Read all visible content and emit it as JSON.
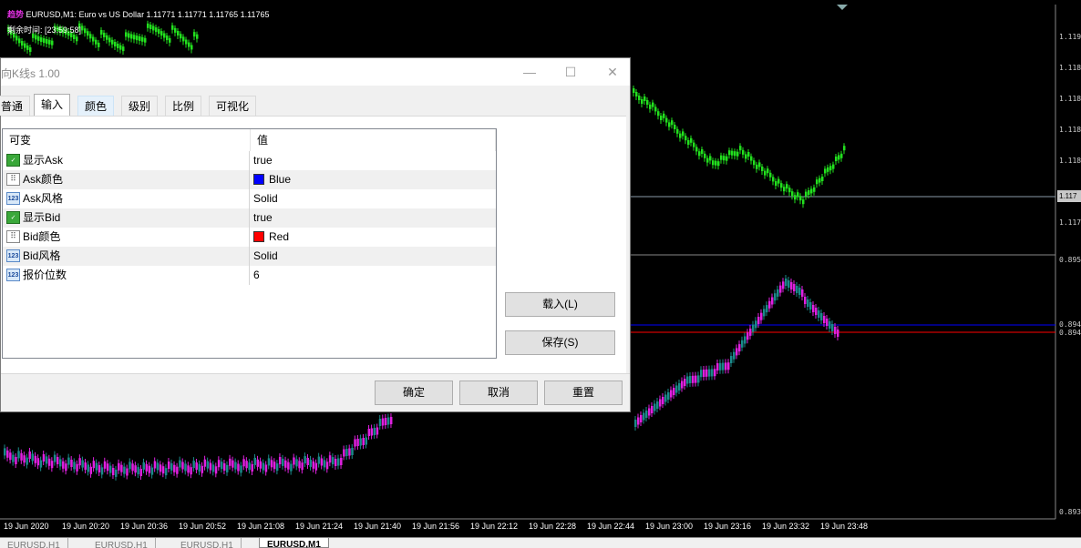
{
  "chart": {
    "symbol_header": "EURUSD,M1:  Euro vs US Dollar  1.11771 1.11771 1.11765 1.11765",
    "logo_text": "趋势",
    "remaining_label": "剩余时间: [23:59:58]",
    "colors": {
      "background": "#000000",
      "bull_upper": "#22e01e",
      "bear_lower": "#e020e0",
      "bull_lower": "#1a8a8a",
      "ask_line": "#0000ff",
      "bid_line": "#ff0000"
    },
    "price_labels": [
      {
        "text": "1.119"
      },
      {
        "text": "1.118"
      },
      {
        "text": "1.118"
      },
      {
        "text": "1.118"
      },
      {
        "text": "1.118"
      },
      {
        "text": "1.117"
      },
      {
        "text": "0.895"
      },
      {
        "text": "0.894"
      },
      {
        "text": "0.894"
      },
      {
        "text": "0.893"
      }
    ],
    "current_price": "1.117",
    "time_labels": [
      "19 Jun 2020",
      "19 Jun 20:20",
      "19 Jun 20:36",
      "19 Jun 20:52",
      "19 Jun 21:08",
      "19 Jun 21:24",
      "19 Jun 21:40",
      "19 Jun 21:56",
      "19 Jun 22:12",
      "19 Jun 22:28",
      "19 Jun 22:44",
      "19 Jun 23:00",
      "19 Jun 23:16",
      "19 Jun 23:32",
      "19 Jun 23:48"
    ],
    "tabs": [
      {
        "label": "EURUSD,H1",
        "active": false
      },
      {
        "label": "EURUSD,H1",
        "active": false
      },
      {
        "label": "EURUSD,H1",
        "active": false
      },
      {
        "label": "EURUSD,M1",
        "active": true
      }
    ]
  },
  "dialog": {
    "title": "向K线s 1.00",
    "minimize": "—",
    "maximize": "☐",
    "close": "✕",
    "tabs": [
      {
        "label": "普通",
        "state": "normal"
      },
      {
        "label": "输入",
        "state": "active"
      },
      {
        "label": "颜色",
        "state": "hl"
      },
      {
        "label": "级别",
        "state": "normal"
      },
      {
        "label": "比例",
        "state": "normal"
      },
      {
        "label": "可视化",
        "state": "normal"
      }
    ],
    "grid": {
      "col_variable": "可变",
      "col_value": "值",
      "rows": [
        {
          "name": "显示Ask",
          "value": "true",
          "icon": "bool"
        },
        {
          "name": "Ask颜色",
          "value": "Blue",
          "icon": "color",
          "swatch": "#0000ff"
        },
        {
          "name": "Ask风格",
          "value": "Solid",
          "icon": "num"
        },
        {
          "name": "显示Bid",
          "value": "true",
          "icon": "bool"
        },
        {
          "name": "Bid颜色",
          "value": "Red",
          "icon": "color",
          "swatch": "#ff0000"
        },
        {
          "name": "Bid风格",
          "value": "Solid",
          "icon": "num"
        },
        {
          "name": "报价位数",
          "value": "6",
          "icon": "num"
        }
      ]
    },
    "load_button": "载入(L)",
    "save_button": "保存(S)",
    "ok_button": "确定",
    "cancel_button": "取消",
    "reset_button": "重置"
  }
}
